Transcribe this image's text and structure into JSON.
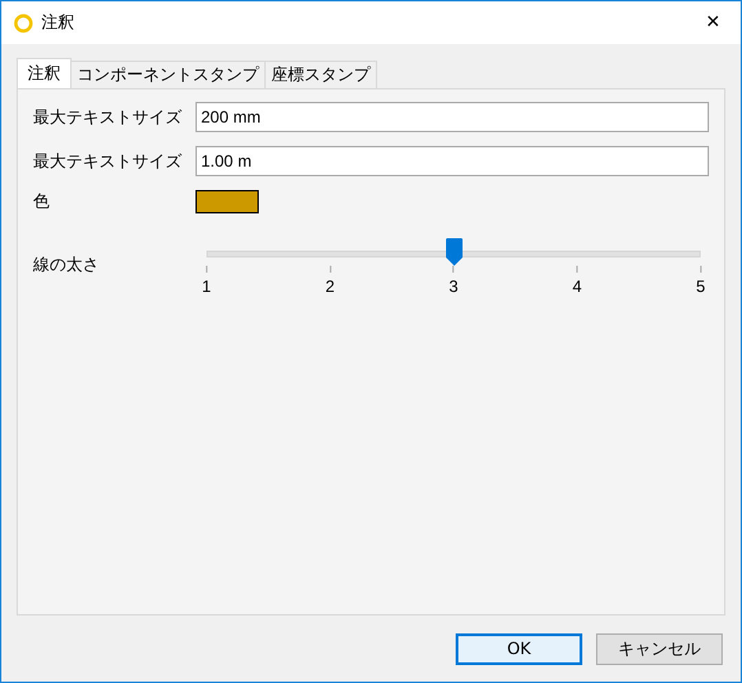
{
  "window": {
    "title": "注釈",
    "close": "✕"
  },
  "tabs": [
    {
      "label": "注釈",
      "selected": true
    },
    {
      "label": "コンポーネントスタンプ",
      "selected": false
    },
    {
      "label": "座標スタンプ",
      "selected": false
    }
  ],
  "fields": [
    {
      "label": "最大テキストサイズ",
      "value": "200 mm"
    },
    {
      "label": "最大テキストサイズ",
      "value": "1.00 m"
    }
  ],
  "color": {
    "label": "色",
    "color": "#cc9900"
  },
  "line_width": {
    "label": "線の太さ",
    "level": 0.5,
    "ticks": [
      "1",
      "2",
      "3",
      "4",
      "5"
    ]
  },
  "buttons": [
    {
      "label": "OK",
      "selected": true
    },
    {
      "label": "キャンセル",
      "selected": false
    }
  ]
}
